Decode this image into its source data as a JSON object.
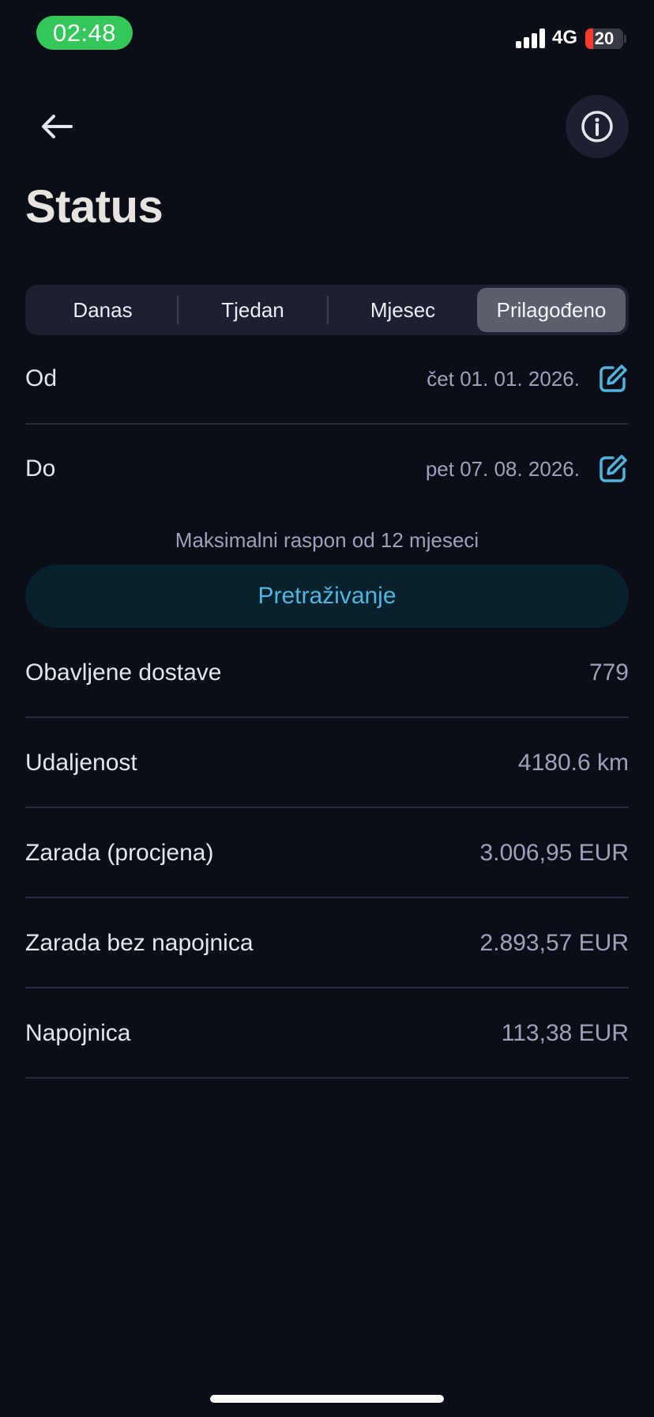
{
  "status_bar": {
    "time": "02:48",
    "network": "4G",
    "battery": "20",
    "battery_level_fraction": 0.2,
    "time_pill_color": "#34c759",
    "battery_color": "#ff3b30"
  },
  "header": {
    "back_icon": "arrow-left-icon",
    "info_icon": "info-circle-icon",
    "title": "Status"
  },
  "tabs": [
    {
      "label": "Danas",
      "active": false
    },
    {
      "label": "Tjedan",
      "active": false
    },
    {
      "label": "Mjesec",
      "active": false
    },
    {
      "label": "Prilagođeno",
      "active": true
    }
  ],
  "range": {
    "from_label": "Od",
    "from_value": "čet 01. 01. 2026.",
    "to_label": "Do",
    "to_value": "pet 07. 08. 2026.",
    "edit_icon": "edit-icon",
    "hint": "Maksimalni raspon od 12 mjeseci"
  },
  "search_button": {
    "label": "Pretraživanje",
    "accent": "#4fb5de"
  },
  "stats": [
    {
      "label": "Obavljene dostave",
      "value": "779"
    },
    {
      "label": "Udaljenost",
      "value": "4180.6 km"
    },
    {
      "label": "Zarada (procjena)",
      "value": "3.006,95 EUR"
    },
    {
      "label": "Zarada bez napojnica",
      "value": "2.893,57 EUR"
    },
    {
      "label": "Napojnica",
      "value": "113,38 EUR"
    }
  ]
}
